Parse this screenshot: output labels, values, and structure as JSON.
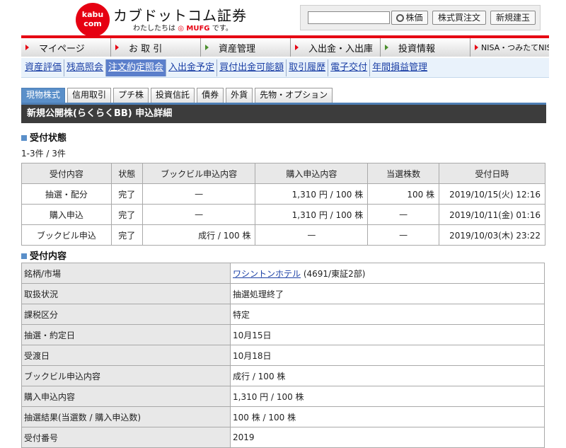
{
  "header": {
    "logo_line1": "kabu",
    "logo_line2": "com",
    "brand_name": "カブドットコム証券",
    "brand_sub_prefix": "わたしたちは",
    "brand_sub_mufg": "MUFG",
    "brand_sub_suffix": "です。",
    "search_value": "",
    "btn_kabuka": "株価",
    "btn_order": "株式買注文",
    "btn_new": "新規建玉"
  },
  "main_nav": [
    {
      "label": "マイページ"
    },
    {
      "label": "お 取 引"
    },
    {
      "label": "資産管理"
    },
    {
      "label": "入出金・入出庫"
    },
    {
      "label": "投資情報"
    },
    {
      "label": "NISA・つみたてNISA"
    }
  ],
  "sub_nav": [
    {
      "label": "資産評価"
    },
    {
      "label": "残高照会"
    },
    {
      "label": "注文約定照会"
    },
    {
      "label": "入出金予定"
    },
    {
      "label": "買付出金可能額"
    },
    {
      "label": "取引履歴"
    },
    {
      "label": "電子交付"
    },
    {
      "label": "年間損益管理"
    }
  ],
  "tabs": [
    {
      "label": "現物株式"
    },
    {
      "label": "信用取引"
    },
    {
      "label": "プチ株"
    },
    {
      "label": "投資信託"
    },
    {
      "label": "債券"
    },
    {
      "label": "外貨"
    },
    {
      "label": "先物・オプション"
    }
  ],
  "page_title": "新規公開株(らくらくBB) 申込詳細",
  "status_section": {
    "heading": "受付状態",
    "count": "1-3件 / 3件",
    "headers": [
      "受付内容",
      "状態",
      "ブックビル申込内容",
      "購入申込内容",
      "当選株数",
      "受付日時"
    ],
    "rows": [
      [
        "抽選・配分",
        "完了",
        "—",
        "1,310 円 / 100 株",
        "100 株",
        "2019/10/15(火) 12:16"
      ],
      [
        "購入申込",
        "完了",
        "—",
        "1,310 円 / 100 株",
        "—",
        "2019/10/11(金) 01:16"
      ],
      [
        "ブックビル申込",
        "完了",
        "成行 / 100 株",
        "—",
        "—",
        "2019/10/03(木) 23:22"
      ]
    ]
  },
  "detail_section": {
    "heading": "受付内容",
    "rows": [
      {
        "key": "銘柄/市場",
        "value": "ワシントンホテル",
        "suffix": " (4691/東証2部)"
      },
      {
        "key": "取扱状況",
        "value": "抽選処理終了"
      },
      {
        "key": "課税区分",
        "value": "特定"
      },
      {
        "key": "抽選・約定日",
        "value": "10月15日"
      },
      {
        "key": "受渡日",
        "value": "10月18日"
      },
      {
        "key": "ブックビル申込内容",
        "value": "成行 / 100 株"
      },
      {
        "key": "購入申込内容",
        "value": "1,310 円 / 100 株"
      },
      {
        "key": "抽選結果(当選数 / 購入申込数)",
        "value": "100 株 / 100 株"
      },
      {
        "key": "受付番号",
        "value": "2019"
      }
    ]
  },
  "colors": {
    "brand_red": "#e60012",
    "active_blue": "#5b7fcb",
    "title_bar": "#3c3c3c"
  }
}
